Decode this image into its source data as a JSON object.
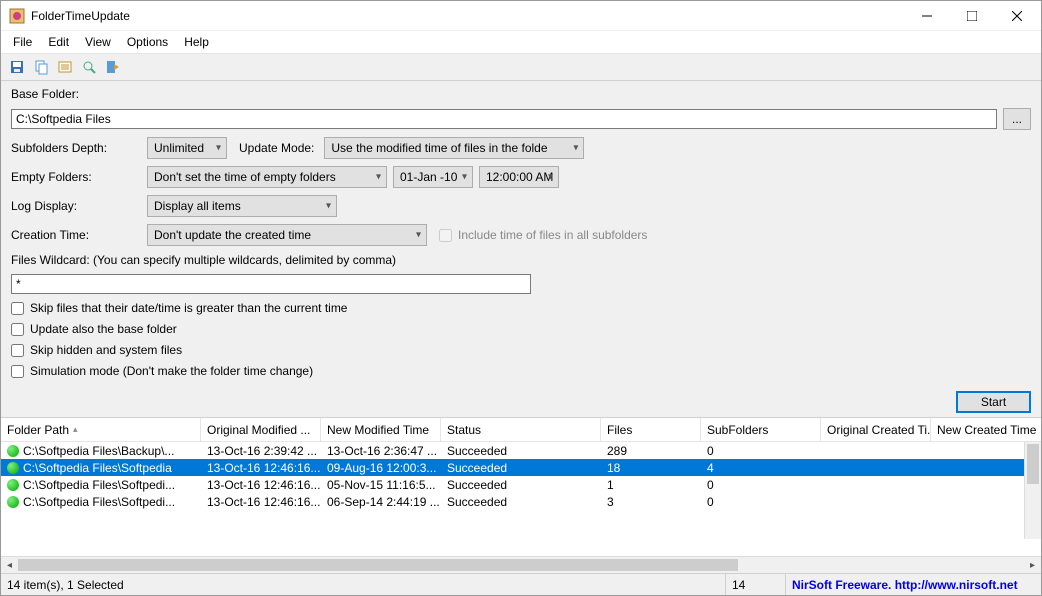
{
  "window": {
    "title": "FolderTimeUpdate"
  },
  "menu": {
    "file": "File",
    "edit": "Edit",
    "view": "View",
    "options": "Options",
    "help": "Help"
  },
  "form": {
    "base_folder_label": "Base Folder:",
    "base_folder_value": "C:\\Softpedia Files",
    "browse": "...",
    "subfolders_depth_label": "Subfolders Depth:",
    "subfolders_depth_value": "Unlimited",
    "update_mode_label": "Update Mode:",
    "update_mode_value": "Use the modified time of files in the folde",
    "empty_folders_label": "Empty Folders:",
    "empty_folders_value": "Don't set the time of empty folders",
    "date_value": "01-Jan -10",
    "time_value": "12:00:00 AM",
    "log_display_label": "Log Display:",
    "log_display_value": "Display all items",
    "creation_time_label": "Creation Time:",
    "creation_time_value": "Don't update the created time",
    "include_subfolders_label": "Include time of files in all subfolders",
    "wildcard_label": "Files Wildcard: (You can specify multiple wildcards, delimited by comma)",
    "wildcard_value": "*",
    "cb_skip_future": "Skip files that their date/time is greater than the current time",
    "cb_update_base": "Update also the base folder",
    "cb_skip_hidden": "Skip hidden and system files",
    "cb_simulation": "Simulation mode (Don't make the folder time change)",
    "start_button": "Start"
  },
  "columns": {
    "path": "Folder Path",
    "omod": "Original Modified ...",
    "nmod": "New Modified Time",
    "status": "Status",
    "files": "Files",
    "sub": "SubFolders",
    "ocr": "Original Created Ti...",
    "ncr": "New Created Time"
  },
  "rows": [
    {
      "path": "C:\\Softpedia Files\\Backup\\...",
      "omod": "13-Oct-16 2:39:42 ...",
      "nmod": "13-Oct-16 2:36:47 ...",
      "status": "Succeeded",
      "files": "289",
      "sub": "0",
      "selected": false
    },
    {
      "path": "C:\\Softpedia Files\\Softpedia",
      "omod": "13-Oct-16 12:46:16...",
      "nmod": "09-Aug-16 12:00:3...",
      "status": "Succeeded",
      "files": "18",
      "sub": "4",
      "selected": true
    },
    {
      "path": "C:\\Softpedia Files\\Softpedi...",
      "omod": "13-Oct-16 12:46:16...",
      "nmod": "05-Nov-15 11:16:5...",
      "status": "Succeeded",
      "files": "1",
      "sub": "0",
      "selected": false
    },
    {
      "path": "C:\\Softpedia Files\\Softpedi...",
      "omod": "13-Oct-16 12:46:16...",
      "nmod": "06-Sep-14 2:44:19 ...",
      "status": "Succeeded",
      "files": "3",
      "sub": "0",
      "selected": false
    }
  ],
  "status": {
    "left": "14 item(s), 1 Selected",
    "count": "14",
    "credit": "NirSoft Freeware.  http://www.nirsoft.net"
  }
}
